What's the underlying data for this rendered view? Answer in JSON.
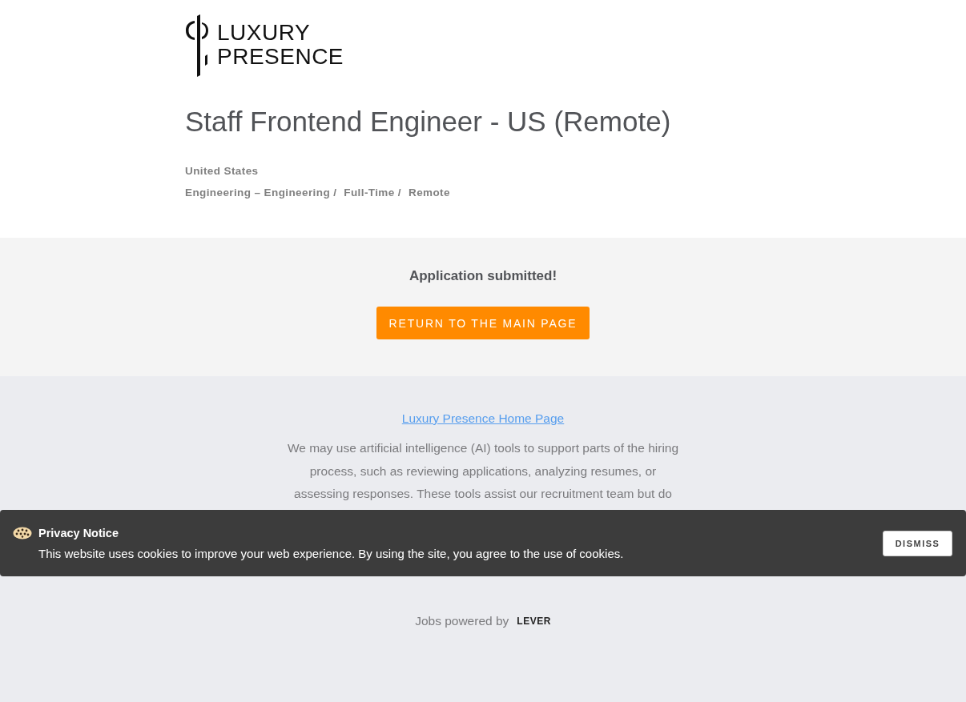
{
  "logo": {
    "line_1": "LUXURY",
    "line_2": "PRESENCE"
  },
  "posting": {
    "title": "Staff Frontend Engineer - US (Remote)",
    "location": "United States",
    "categories": [
      "Engineering – Engineering /",
      "Full-Time /",
      "Remote"
    ]
  },
  "confirmation": {
    "message": "Application submitted!",
    "button": "RETURN TO THE MAIN PAGE"
  },
  "footer": {
    "home_link": "Luxury Presence Home Page",
    "notice": "We may use artificial intelligence (AI) tools to support parts of the hiring process, such as reviewing applications, analyzing resumes, or assessing responses. These tools assist our recruitment team but do",
    "powered_by": "Jobs powered by",
    "lever_logo": "LEVER"
  },
  "cookie_banner": {
    "title": "Privacy Notice",
    "message": "This website uses cookies to improve your web experience. By using the site, you agree to the use of cookies.",
    "button": "DISMISS"
  }
}
